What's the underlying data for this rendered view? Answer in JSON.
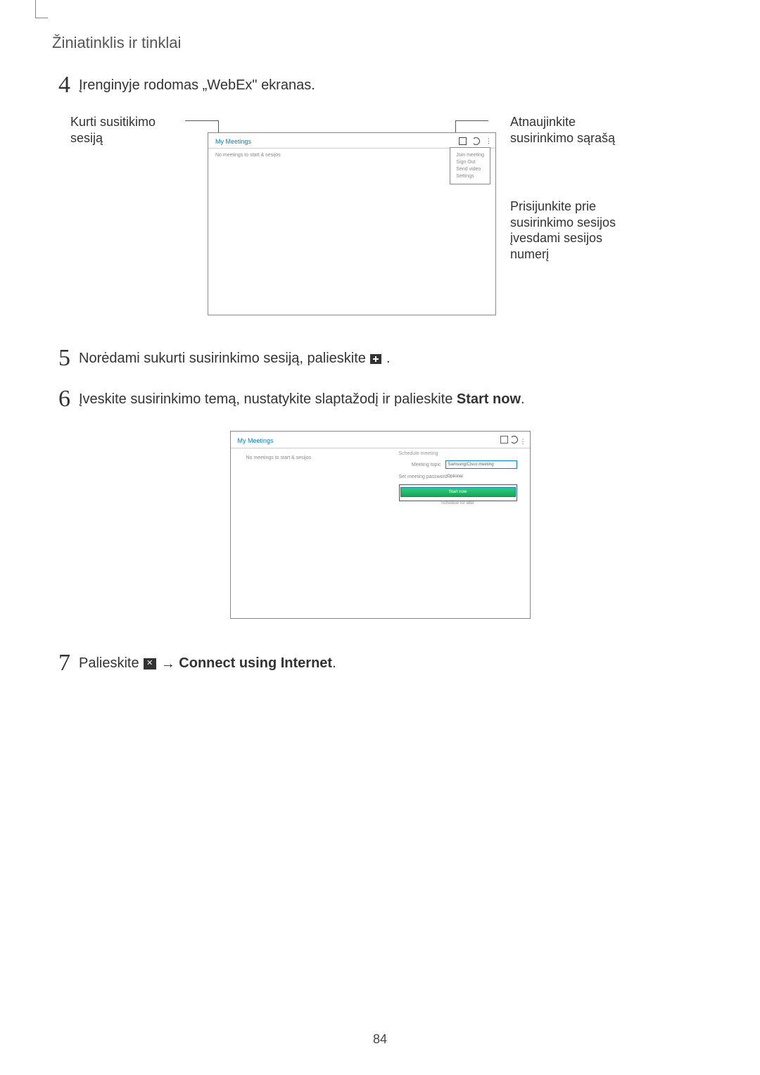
{
  "header": "Žiniatinklis ir tinklai",
  "step4": {
    "num": "4",
    "text": "Įrenginyje rodomas „WebEx\" ekranas."
  },
  "annotation": {
    "label_left": "Kurti susitikimo sesiją",
    "label_top_right_l1": "Atnaujinkite",
    "label_top_right_l2": "susirinkimo sąrašą",
    "label_mid_right_l1": "Prisijunkite prie",
    "label_mid_right_l2": "susirinkimo sesijos",
    "label_mid_right_l3": "įvesdami sesijos",
    "label_mid_right_l4": "numerį"
  },
  "mock1": {
    "title": "My Meetings",
    "body_text": "No meetings to start & sesijos",
    "popup": {
      "item1": "Join meeting",
      "item2": "Sign Out",
      "item3": "Send video",
      "item4": "Settings"
    }
  },
  "step5": {
    "num": "5",
    "text_before": "Norėdami sukurti susirinkimo sesiją, palieskite ",
    "text_after": "."
  },
  "step6": {
    "num": "6",
    "text_before": "Įveskite susirinkimo temą, nustatykite slaptažodį ir palieskite ",
    "bold": "Start now",
    "text_after": "."
  },
  "mock2": {
    "title": "My Meetings",
    "left_text": "No meetings to start & sesijos",
    "panel_title": "Schedule meeting",
    "row1_label": "Meeting topic",
    "row1_value": "Samsung/Cisco meeting",
    "row2_label": "Set meeting password",
    "row2_value": "Optional",
    "start_btn": "Start now",
    "sched_link": "Schedule for later"
  },
  "step7": {
    "num": "7",
    "text_before": "Palieskite ",
    "arrow": "→",
    "bold": "Connect using Internet",
    "text_after": "."
  },
  "page_number": "84"
}
